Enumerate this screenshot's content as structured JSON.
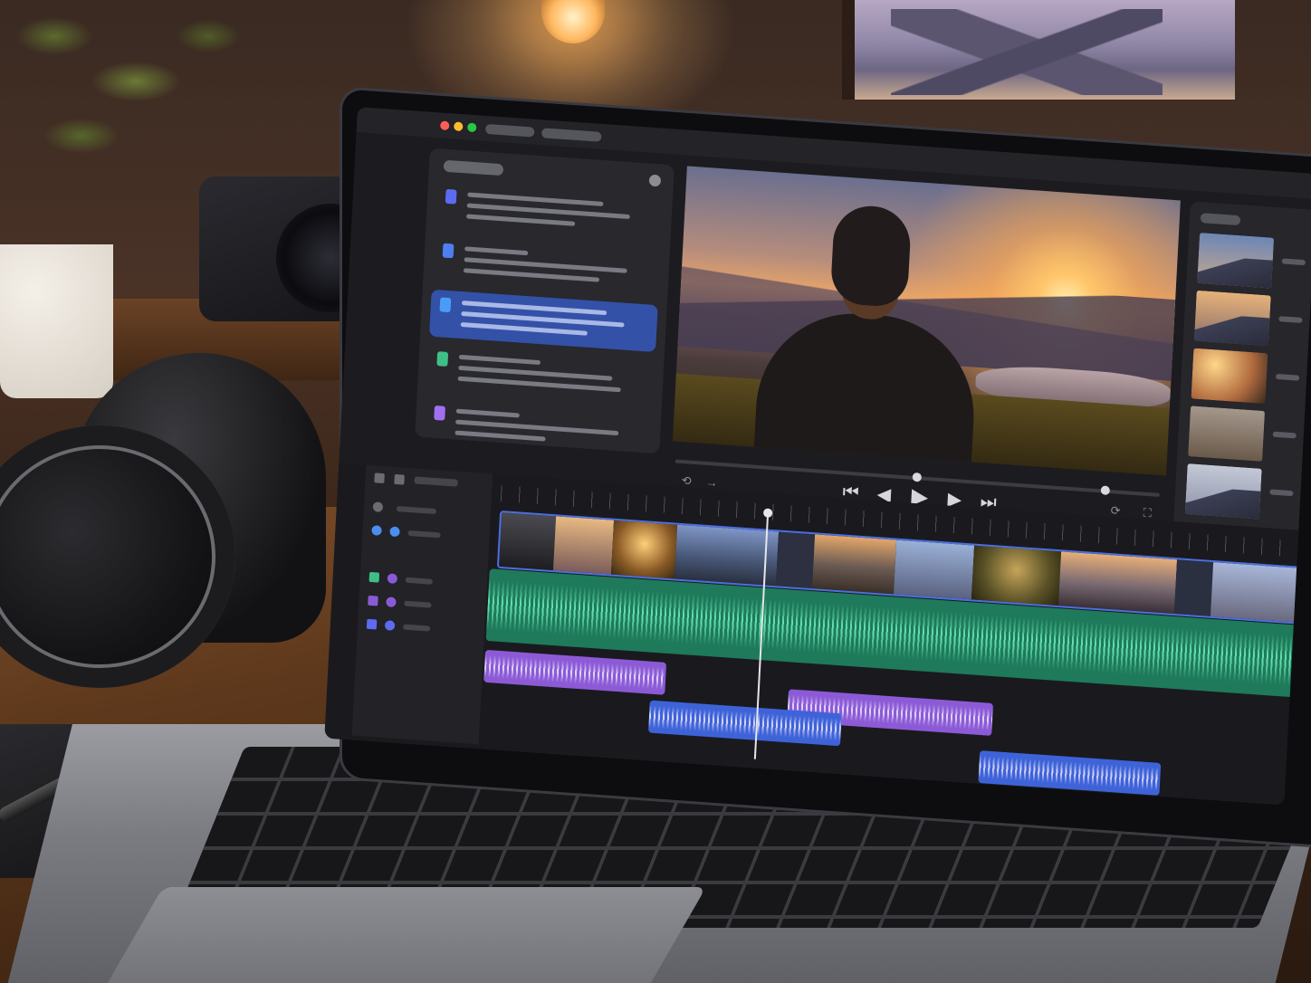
{
  "app": {
    "window_title": "",
    "accent": "#4c6fe0"
  },
  "titlebar": {
    "controls": [
      "close",
      "minimize",
      "zoom"
    ],
    "colors": {
      "close": "#ff5f57",
      "minimize": "#febc2e",
      "zoom": "#28c840"
    }
  },
  "media_panel": {
    "items": [
      {
        "chip_color": "#5b6cf0",
        "selected": false
      },
      {
        "chip_color": "#4d7ff0",
        "selected": false
      },
      {
        "chip_color": "#4a9df5",
        "selected": true
      },
      {
        "chip_color": "#3fbf87",
        "selected": false
      },
      {
        "chip_color": "#a16ff0",
        "selected": false
      }
    ]
  },
  "viewer": {
    "playhead_progress": 0.5,
    "controls": [
      "undo-icon",
      "redo-icon",
      "skip-back-icon",
      "step-back-icon",
      "play-icon",
      "step-forward-icon",
      "skip-forward-icon",
      "loop-icon",
      "fullscreen-icon"
    ]
  },
  "browser_panel": {
    "thumbnails": 5
  },
  "timeline": {
    "tracks": [
      {
        "type": "video",
        "color": "#4c6fe0"
      },
      {
        "type": "audio",
        "color": "#1e7a5a"
      },
      {
        "type": "audio",
        "color": "#8c5ad6"
      },
      {
        "type": "audio",
        "color": "#3e63d8"
      }
    ],
    "playhead_position": 0.34
  }
}
